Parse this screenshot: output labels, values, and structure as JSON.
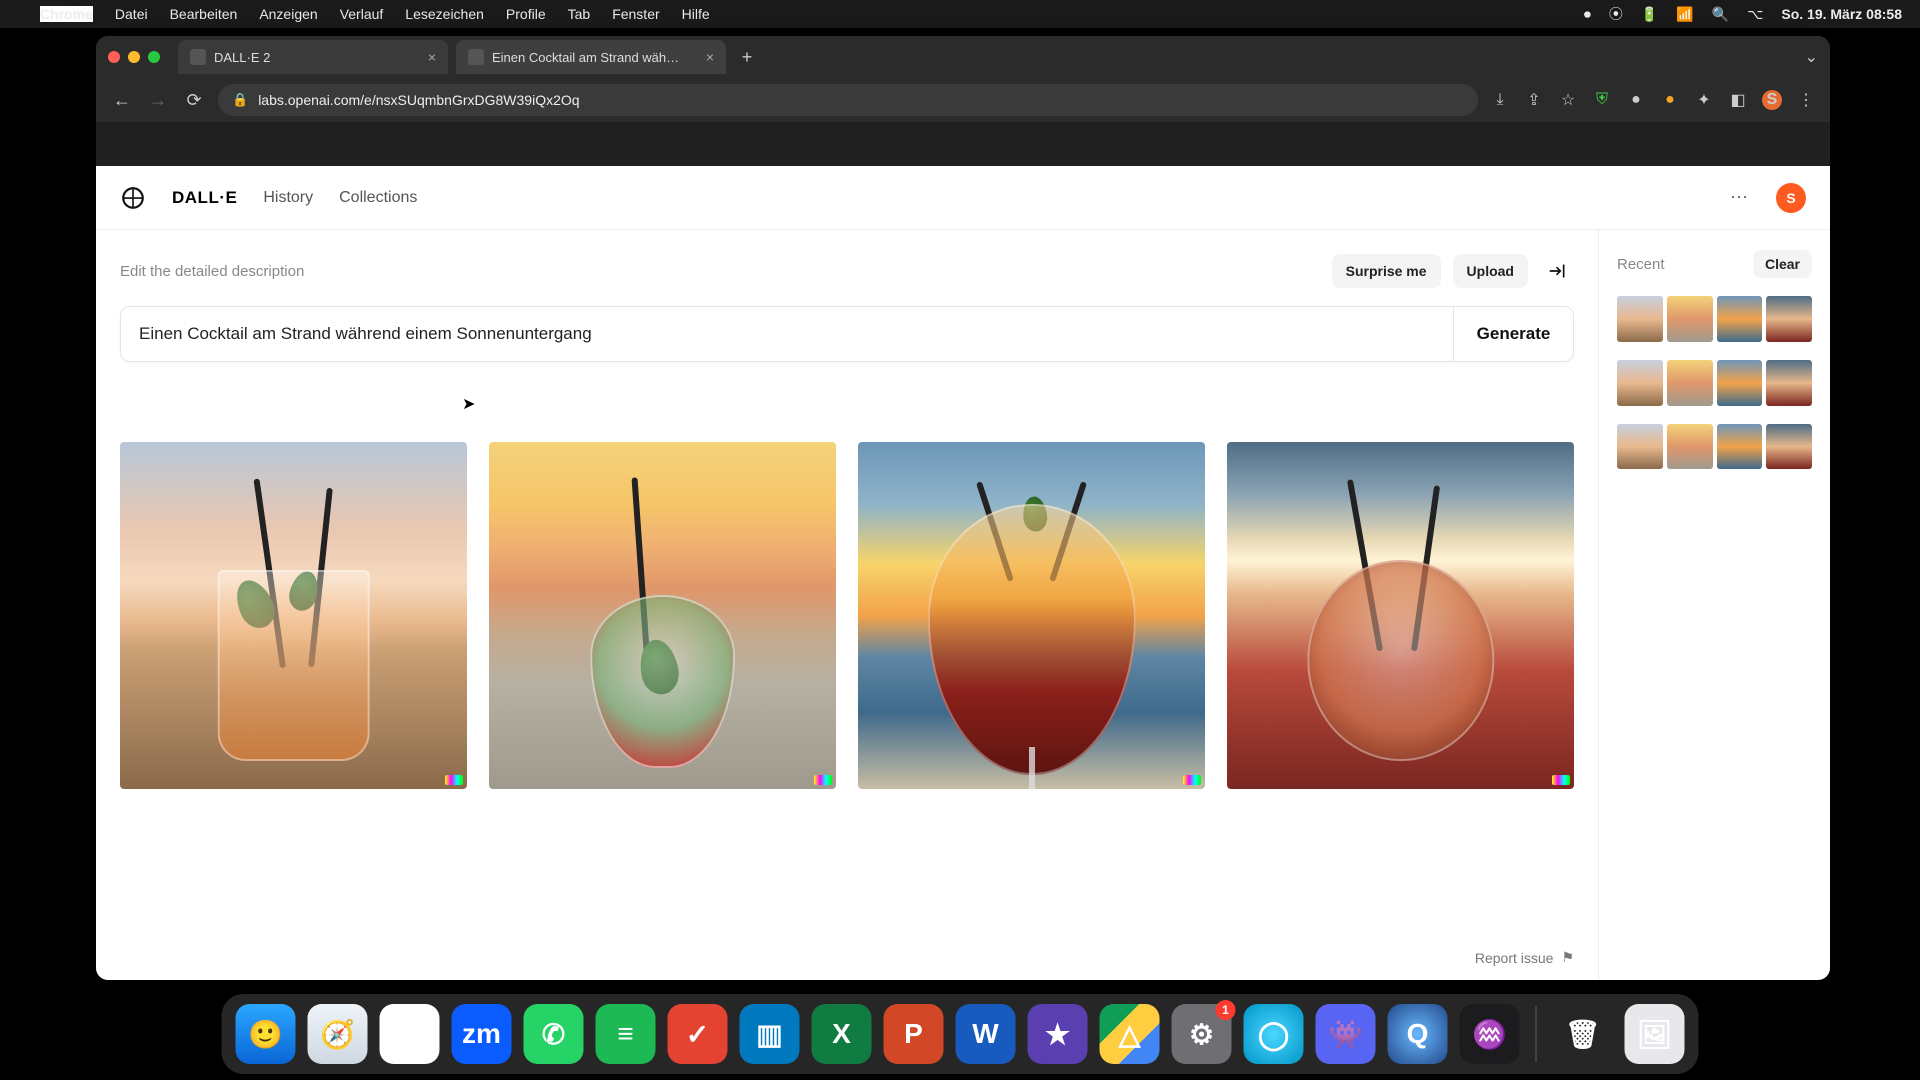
{
  "menubar": {
    "app": "Chrome",
    "items": [
      "Datei",
      "Bearbeiten",
      "Anzeigen",
      "Verlauf",
      "Lesezeichen",
      "Profile",
      "Tab",
      "Fenster",
      "Hilfe"
    ],
    "clock": "So. 19. März  08:58"
  },
  "tabs": [
    {
      "title": "DALL·E 2",
      "active": false
    },
    {
      "title": "Einen Cocktail am Strand wäh…",
      "active": true
    }
  ],
  "omnibox": {
    "url": "labs.openai.com/e/nsxSUqmbnGrxDG8W39iQx2Oq"
  },
  "header": {
    "wordmark": "DALL·E",
    "nav": [
      "History",
      "Collections"
    ],
    "avatar": "S"
  },
  "editor": {
    "hint": "Edit the detailed description",
    "surprise": "Surprise me",
    "upload": "Upload",
    "prompt": "Einen Cocktail am Strand während einem Sonnenuntergang",
    "generate": "Generate"
  },
  "sidebar": {
    "recent": "Recent",
    "clear": "Clear"
  },
  "report": "Report issue",
  "dock": {
    "apps": [
      {
        "name": "finder",
        "bg": "linear-gradient(180deg,#2aa7ff,#0a66d6)",
        "glyph": "🙂"
      },
      {
        "name": "safari",
        "bg": "linear-gradient(180deg,#eef3f8,#cfd8e2)",
        "glyph": "🧭"
      },
      {
        "name": "chrome",
        "bg": "#fff",
        "glyph": "◉"
      },
      {
        "name": "zoom",
        "bg": "#0b5cff",
        "glyph": "zm"
      },
      {
        "name": "whatsapp",
        "bg": "#25d366",
        "glyph": "✆"
      },
      {
        "name": "spotify",
        "bg": "#1db954",
        "glyph": "≡"
      },
      {
        "name": "todoist",
        "bg": "#e44332",
        "glyph": "✓"
      },
      {
        "name": "trello",
        "bg": "#0079bf",
        "glyph": "▥"
      },
      {
        "name": "excel",
        "bg": "#107c41",
        "glyph": "X"
      },
      {
        "name": "powerpoint",
        "bg": "#d24726",
        "glyph": "P"
      },
      {
        "name": "word",
        "bg": "#185abd",
        "glyph": "W"
      },
      {
        "name": "imovie",
        "bg": "#5a3fb0",
        "glyph": "★"
      },
      {
        "name": "drive",
        "bg": "linear-gradient(135deg,#0f9d58 33%,#ffcd40 33% 66%,#4285f4 66%)",
        "glyph": "△"
      },
      {
        "name": "settings",
        "bg": "#6e6e73",
        "glyph": "⚙",
        "badge": "1"
      },
      {
        "name": "app-circle",
        "bg": "radial-gradient(circle,#4ad6ff,#0096c7)",
        "glyph": "◯"
      },
      {
        "name": "discord",
        "bg": "#5865f2",
        "glyph": "👾"
      },
      {
        "name": "quicktime",
        "bg": "radial-gradient(circle,#6bb7ff,#214a8a)",
        "glyph": "Q"
      },
      {
        "name": "voice-memos",
        "bg": "#1c1c1e",
        "glyph": "♒"
      }
    ],
    "right": [
      {
        "name": "preview",
        "bg": "#e8e8ec",
        "glyph": "🖼"
      },
      {
        "name": "trash",
        "bg": "transparent",
        "glyph": "🗑"
      }
    ]
  }
}
